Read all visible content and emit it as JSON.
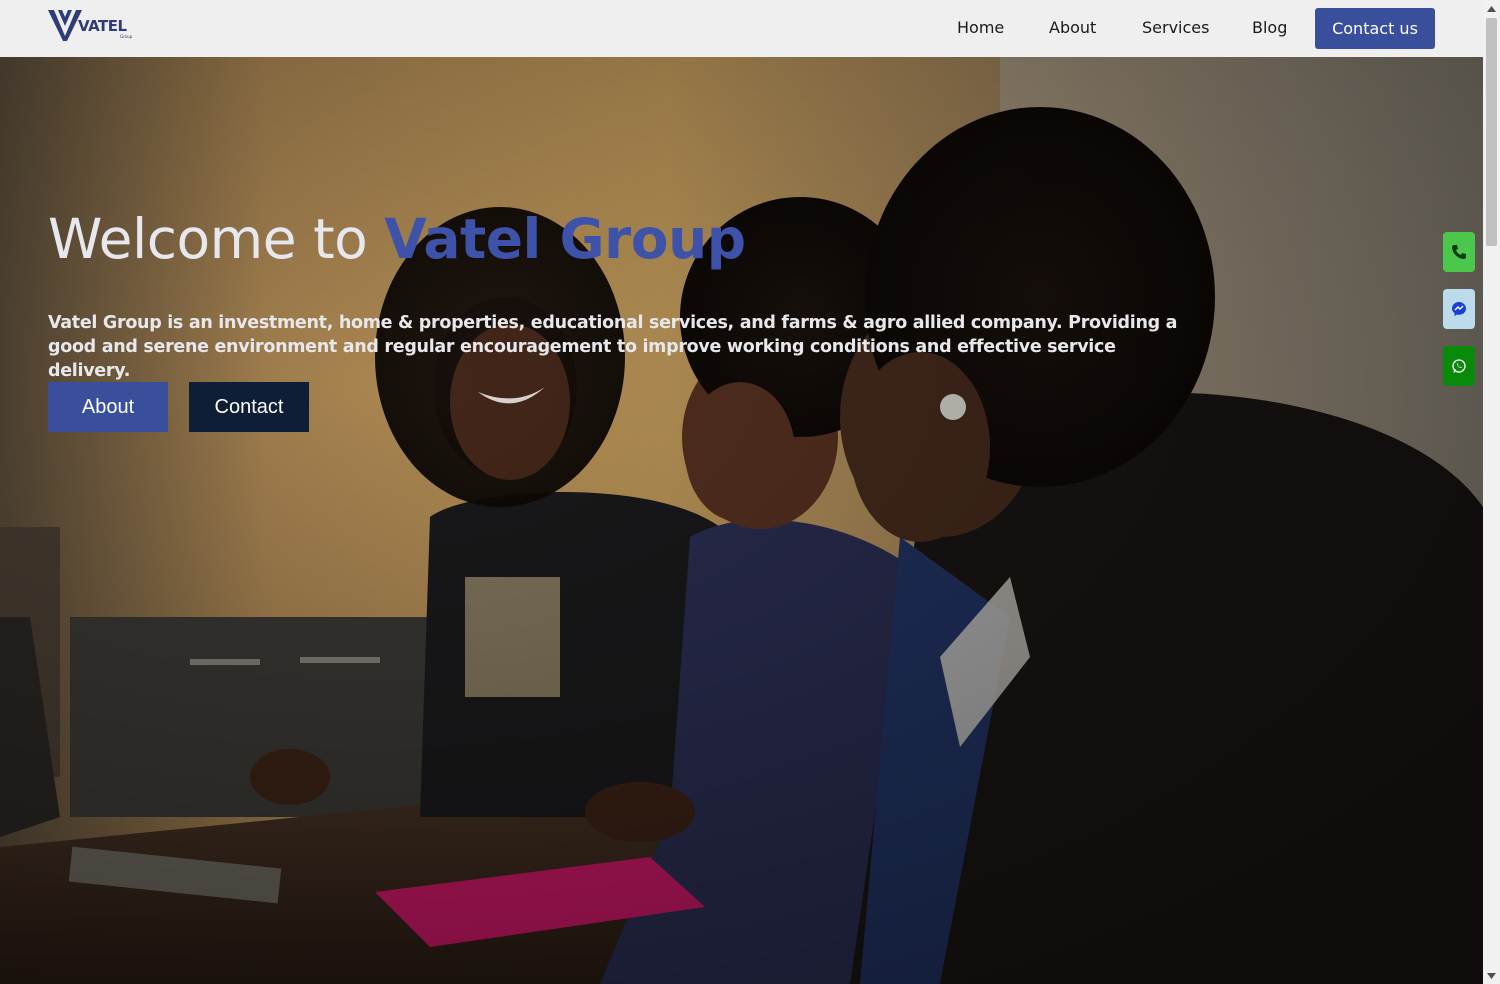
{
  "brand": {
    "logo_text": "VATEL",
    "logo_sub": "Group",
    "color": "#2e3d7a"
  },
  "nav": {
    "items": [
      {
        "label": "Home"
      },
      {
        "label": "About"
      },
      {
        "label": "Services"
      },
      {
        "label": "Blog"
      }
    ],
    "cta_label": "Contact us",
    "accent": "#3a4f9c"
  },
  "hero": {
    "title_prefix": "Welcome to ",
    "title_accent": "Vatel Group",
    "description": "Vatel Group is an investment, home & properties, educational services, and farms & agro allied company. Providing a good and serene environment and regular encouragement to improve working conditions and effective service delivery.",
    "buttons": {
      "about": "About",
      "contact": "Contact"
    },
    "accent_color": "#3d52a8"
  },
  "floating_contacts": [
    {
      "icon": "phone-icon",
      "color": "#4bc84b"
    },
    {
      "icon": "messenger-icon",
      "color": "#bcdcec"
    },
    {
      "icon": "whatsapp-icon",
      "color": "#0a8a0a"
    }
  ]
}
